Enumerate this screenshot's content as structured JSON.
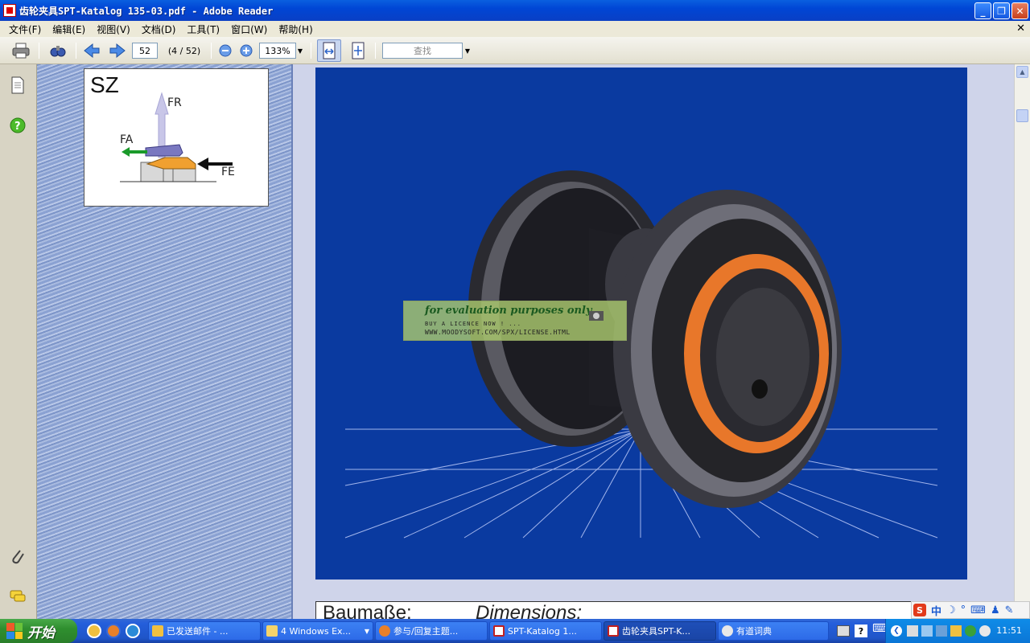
{
  "window": {
    "title": "齿轮夹具SPT-Katalog 135-03.pdf - Adobe Reader",
    "min_glyph": "_",
    "max_glyph": "❐",
    "close_glyph": "✕"
  },
  "menu": {
    "items": [
      "文件(F)",
      "编辑(E)",
      "视图(V)",
      "文档(D)",
      "工具(T)",
      "窗口(W)",
      "帮助(H)"
    ],
    "close_glyph": "✕"
  },
  "toolbar": {
    "page_number": "52",
    "page_total": "(4 / 52)",
    "zoom": "133%",
    "search_placeholder": "查找"
  },
  "document": {
    "diagram_title": "SZ",
    "label_fr": "FR",
    "label_fa": "FA",
    "label_fe": "FE",
    "dimensions_de": "Baumaße:",
    "dimensions_en": "Dimensions:"
  },
  "watermark": {
    "line1": "for evaluation purposes only.",
    "line2": "BUY A LICENCE NOW ! ...",
    "line3": "WWW.MOODYSOFT.COM/SPX/LICENSE.HTML"
  },
  "ime": {
    "mode": "中"
  },
  "taskbar": {
    "start_label": "开始",
    "buttons": [
      "已发送邮件 - ...",
      "4 Windows Ex...",
      "参与/回复主题...",
      "SPT-Katalog 1...",
      "齿轮夹具SPT-K...",
      "有道词典"
    ],
    "clock": "11:51"
  },
  "colors": {
    "page_blue": "#0a3aa0",
    "titlebar_blue": "#0046d5",
    "arrow_green": "#1a9a2a",
    "part_orange": "#f0a030",
    "part_purple": "#7a78c0"
  }
}
